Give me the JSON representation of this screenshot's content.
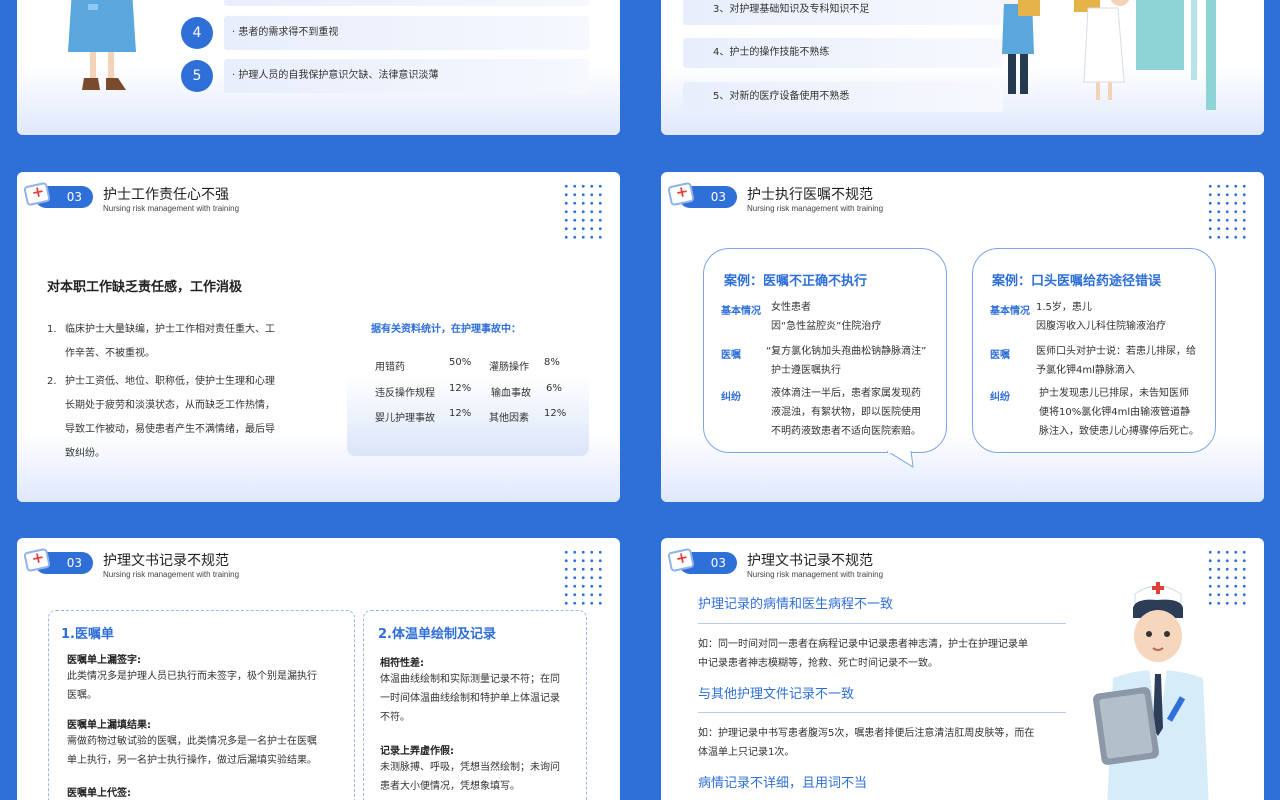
{
  "slide1": {
    "item4_num": "4",
    "item4_text": "· 患者的需求得不到重视",
    "item5_num": "5",
    "item5_text": "· 护理人员的自我保护意识欠缺、法律意识淡薄"
  },
  "slide2": {
    "items": [
      "3、对护理基础知识及专科知识不足",
      "4、护士的操作技能不熟练",
      "5、对新的医疗设备使用不熟悉"
    ]
  },
  "slide3": {
    "num": "03",
    "title": "护士工作责任心不强",
    "subtitle": "Nursing risk management with training",
    "heading": "对本职工作缺乏责任感，工作消极",
    "list": [
      {
        "n": "1.",
        "lines": [
          "临床护士大量缺编，护士工作相对责任重大、工",
          "作辛苦、不被重视。"
        ]
      },
      {
        "n": "2.",
        "lines": [
          "护士工资低、地位、职称低，使护士生理和心理",
          "长期处于疲劳和淡漠状态，从而缺乏工作热情，",
          "导致工作被动，易使患者产生不满情绪，最后导",
          "致纠纷。"
        ]
      }
    ],
    "stats_title": "据有关资料统计，在护理事故中：",
    "stats": [
      [
        "用错药",
        "50%",
        "灌肠操作",
        "8%"
      ],
      [
        "违反操作规程",
        "12%",
        "输血事故",
        "6%"
      ],
      [
        "婴儿护理事故",
        "12%",
        "其他因素",
        "12%"
      ]
    ]
  },
  "slide4": {
    "num": "03",
    "title": "护士执行医嘱不规范",
    "subtitle": "Nursing risk management with training",
    "case1": {
      "title": "案例：医嘱不正确不执行",
      "l1": "基本情况",
      "v1": [
        "女性患者",
        "因“急性盆腔炎”住院治疗"
      ],
      "l2": "医嘱",
      "v2": [
        "“复方氯化钠加头孢曲松钠静脉滴注”",
        "护士遵医嘱执行"
      ],
      "l3": "纠纷",
      "v3": [
        "液体滴注一半后，患者家属发现药",
        "液混浊，有絮状物，即以医院使用",
        "不明药液致患者不适向医院索赔。"
      ]
    },
    "case2": {
      "title": "案例：口头医嘱给药途径错误",
      "l1": "基本情况",
      "v1": [
        "1.5岁，患儿",
        "因腹泻收入儿科住院输液治疗"
      ],
      "l2": "医嘱",
      "v2": [
        "医师口头对护士说：若患儿排尿，给",
        "予氯化钾4ml静脉滴入"
      ],
      "l3": "纠纷",
      "v3": [
        "护士发现患儿已排尿，未告知医师",
        "便将10%氯化钾4ml由输液管道静",
        "脉注入，致使患儿心搏骤停后死亡。"
      ]
    }
  },
  "slide5": {
    "num": "03",
    "title": "护理文书记录不规范",
    "subtitle": "Nursing risk management with training",
    "box1": {
      "title": "1.医嘱单",
      "h1": "医嘱单上漏签字:",
      "b1": [
        "此类情况多是护理人员已执行而未签字，极个别是漏执行",
        "医嘱。"
      ],
      "h2": "医嘱单上漏填结果:",
      "b2": [
        "需做药物过敏试验的医嘱，此类情况多是一名护士在医嘱",
        "单上执行，另一名护士执行操作，做过后漏填实验结果。"
      ],
      "h3": "医嘱单上代签:"
    },
    "box2": {
      "title": "2.体温单绘制及记录",
      "h1": "相符性差:",
      "b1": [
        "体温曲线绘制和实际测量记录不符；在同",
        "一时间体温曲线绘制和特护单上体温记录",
        "不符。"
      ],
      "h2": "记录上弄虚作假:",
      "b2": [
        "未测脉搏、呼吸，凭想当然绘制；未询问",
        "患者大小便情况，凭想象填写。"
      ]
    }
  },
  "slide6": {
    "num": "03",
    "title": "护理文书记录不规范",
    "subtitle": "Nursing risk management with training",
    "sec1_title": "护理记录的病情和医生病程不一致",
    "sec1_body": [
      "如：同一时间对同一患者在病程记录中记录患者神志清，护士在护理记录单",
      "中记录患者神志模糊等，抢救、死亡时间记录不一致。"
    ],
    "sec2_title": "与其他护理文件记录不一致",
    "sec2_body": [
      "如：护理记录中书写患者腹泻5次，嘱患者排便后注意清洁肛周皮肤等，而在",
      "体温单上只记录1次。"
    ],
    "sec3_title": "病情记录不详细，且用词不当"
  }
}
